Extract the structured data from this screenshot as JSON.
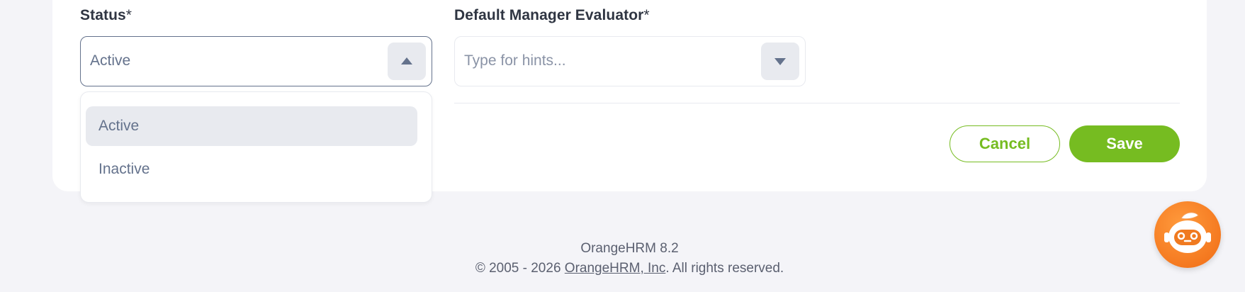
{
  "form": {
    "status": {
      "label": "Status",
      "required_mark": "*",
      "value": "Active",
      "options": [
        "Active",
        "Inactive"
      ]
    },
    "manager_evaluator": {
      "label": "Default Manager Evaluator",
      "required_mark": "*",
      "placeholder": "Type for hints..."
    },
    "buttons": {
      "cancel": "Cancel",
      "save": "Save"
    }
  },
  "footer": {
    "version": "OrangeHRM 8.2",
    "copyright_prefix": "© 2005 - 2026 ",
    "company_link": "OrangeHRM, Inc",
    "copyright_suffix": ". All rights reserved."
  },
  "colors": {
    "accent": "#76bc21",
    "chatbot": "#f47c20",
    "text": "#64728c"
  },
  "icons": {
    "status_caret": "caret-up-icon",
    "manager_caret": "caret-down-icon",
    "chatbot": "robot-assistant-icon"
  }
}
